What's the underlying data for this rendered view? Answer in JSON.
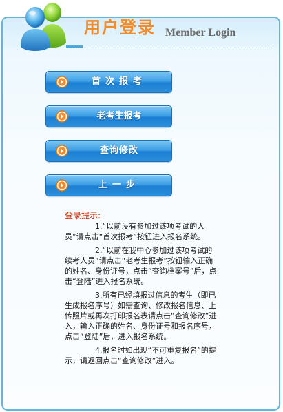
{
  "header": {
    "title_zh": "用户登录",
    "title_en": "Member Login"
  },
  "buttons": [
    {
      "label": "首次报考",
      "icon": "arrow-right-circle-icon"
    },
    {
      "label": "老考生报考",
      "icon": "arrow-right-circle-icon"
    },
    {
      "label": "查询修改",
      "icon": "arrow-right-circle-icon"
    },
    {
      "label": "上一步",
      "icon": "arrow-right-circle-icon"
    }
  ],
  "tips": {
    "title": "登录提示:",
    "items": [
      "1.“以前没有参加过该项考试的人员”请点击“首次报考”按钮进入报名系统。",
      "2.“以前在我中心参加过该项考试的续考人员”请点击“老考生报考”按钮输入正确的姓名、身份证号，点击“查询档案号”后，点击“登陆”进入报名系统。",
      "3.所有已经填报过信息的考生（即已生成报名序号）如需查询、修改报名信息、上传照片或再次打印报名表请点击“查询修改”进入，输入正确的姓名、身份证号和报名序号，点击“登陆”后，进入报名系统。",
      "4.报名时如出现“不可重复报名”的提示，请返回点击“查询修改”进入。"
    ]
  },
  "colors": {
    "panel_border": "#5fb6df",
    "title_orange": "#f08c2c",
    "button_blue": "#2b8fdc",
    "tip_title_red": "#cc2200"
  }
}
